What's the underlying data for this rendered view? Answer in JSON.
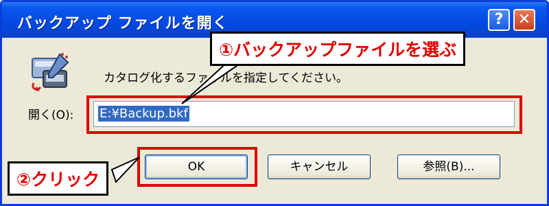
{
  "window": {
    "title": "バックアップ ファイルを開く",
    "help_label": "?",
    "close_label": "✕"
  },
  "dialog": {
    "instruction": "カタログ化するファイルを指定してください。",
    "open_label": "開く(O):",
    "file_value": "E:¥Backup.bkf"
  },
  "buttons": {
    "ok": "OK",
    "cancel": "キャンセル",
    "browse": "参照(B)..."
  },
  "annotations": {
    "step1": "①バックアップファイルを選ぶ",
    "step2": "②クリック"
  },
  "colors": {
    "title_bar": "#0348e0",
    "highlight": "#e10000",
    "selection": "#316ac5"
  },
  "icons": {
    "app_icon": "backup-catalog-icon",
    "help": "help-icon",
    "close": "close-icon"
  }
}
